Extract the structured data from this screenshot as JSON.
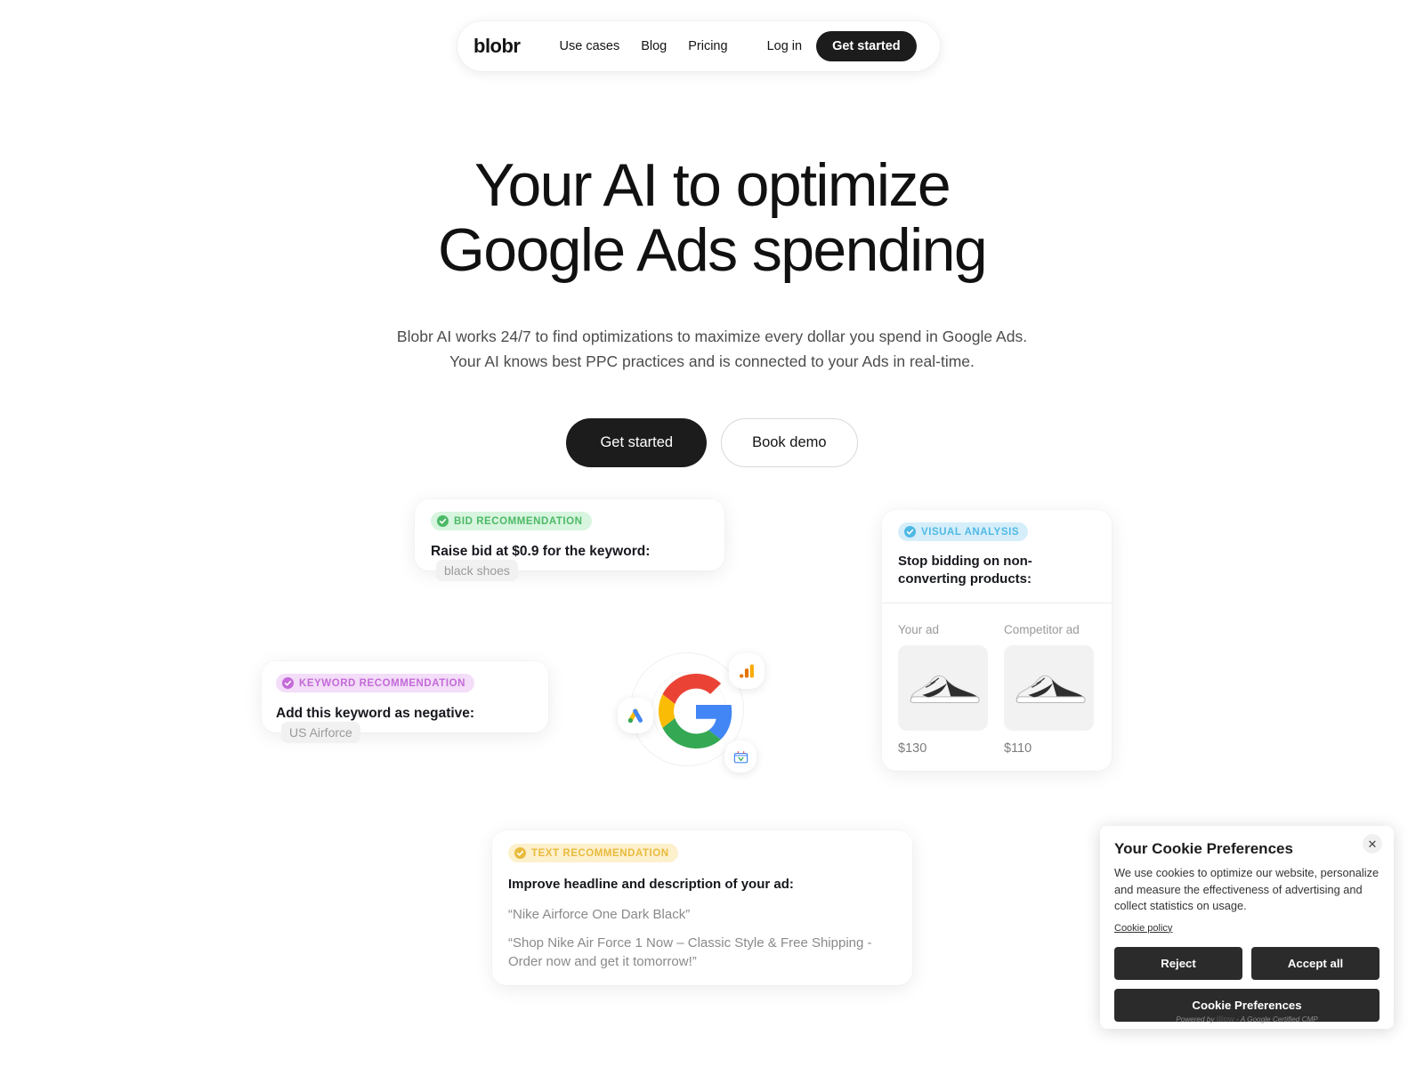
{
  "nav": {
    "logo": "blobr",
    "links": [
      {
        "label": "Use cases"
      },
      {
        "label": "Blog"
      },
      {
        "label": "Pricing"
      }
    ],
    "login_label": "Log in",
    "cta_label": "Get started"
  },
  "hero": {
    "title_line1": "Your AI to optimize",
    "title_line2": "Google Ads spending",
    "subtitle": "Blobr AI works 24/7 to find optimizations to maximize every dollar you spend in Google Ads. Your AI knows best PPC practices and is connected to your Ads in real-time.",
    "primary_cta": "Get started",
    "secondary_cta": "Book demo"
  },
  "cards": {
    "bid": {
      "badge": "BID RECOMMENDATION",
      "badge_color": "#4cb966",
      "badge_bg": "#d8f5df",
      "text": "Raise bid at $0.9 for the keyword:",
      "chip": "black shoes"
    },
    "keyword": {
      "badge": "KEYWORD RECOMMENDATION",
      "badge_color": "#c46ad9",
      "badge_bg": "#f3ddf8",
      "text": "Add this keyword as negative:",
      "chip": "US Airforce"
    },
    "visual": {
      "badge": "VISUAL ANALYSIS",
      "badge_color": "#4fb9e5",
      "badge_bg": "#d5eefa",
      "title": "Stop bidding on non-converting products:",
      "columns": [
        {
          "label": "Your ad",
          "price": "$130"
        },
        {
          "label": "Competitor ad",
          "price": "$110"
        }
      ]
    },
    "text": {
      "badge": "TEXT RECOMMENDATION",
      "badge_color": "#e8bb3c",
      "badge_bg": "#fdf0cd",
      "title": "Improve headline and description of your ad:",
      "headline": "“Nike Airforce One Dark Black”",
      "description": "“Shop Nike Air Force 1 Now – Classic Style & Free Shipping - Order now and get it tomorrow!”"
    }
  },
  "illustration": {
    "google_logo": "google-logo",
    "google_ads_icon": "google-ads-icon",
    "google_analytics_icon": "google-analytics-icon",
    "merchant_center_icon": "google-merchant-center-icon"
  },
  "cookie": {
    "title": "Your Cookie Preferences",
    "body": "We use cookies to optimize our website, personalize and measure the effectiveness of advertising and collect statistics on usage.",
    "policy_link": "Cookie policy",
    "reject_label": "Reject",
    "accept_label": "Accept all",
    "preferences_label": "Cookie Preferences",
    "powered_prefix": "Powered by ",
    "powered_brand": "illow",
    "powered_suffix": " - A Google Certified CMP",
    "close_icon": "✕"
  }
}
